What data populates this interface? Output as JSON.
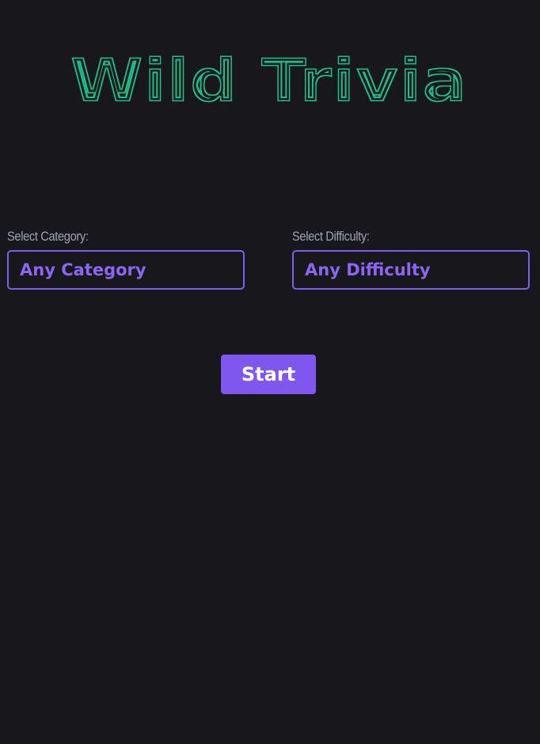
{
  "app": {
    "title": "Wild Trivia",
    "logo_color": "#1ec088",
    "background_color": "#18171c"
  },
  "category": {
    "label": "Select Category:",
    "selected": "Any Category"
  },
  "difficulty": {
    "label": "Select Difficulty:",
    "selected": "Any Difficulty"
  },
  "start_button": {
    "label": "Start",
    "color": "#7f57ef"
  },
  "accent_color": "#7c5ee8"
}
